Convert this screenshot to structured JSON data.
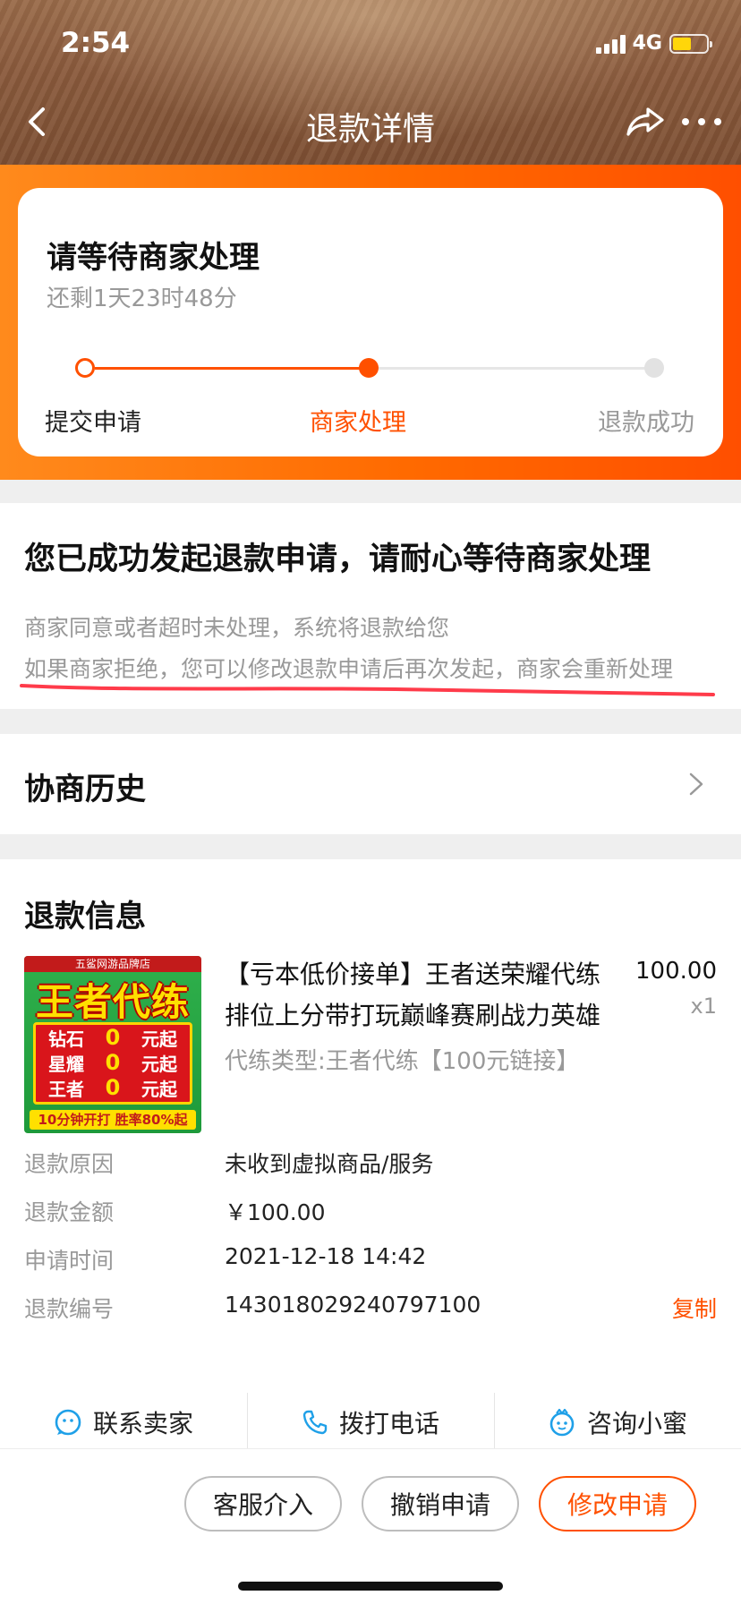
{
  "status_bar": {
    "time": "2:54",
    "network": "4G"
  },
  "nav": {
    "title": "退款详情"
  },
  "progress": {
    "title": "请等待商家处理",
    "remaining": "还剩1天23时48分",
    "steps": [
      "提交申请",
      "商家处理",
      "退款成功"
    ],
    "current_step": 2
  },
  "notice": {
    "title": "您已成功发起退款申请，请耐心等待商家处理",
    "line1": "商家同意或者超时未处理，系统将退款给您",
    "line2": "如果商家拒绝，您可以修改退款申请后再次发起，商家会重新处理"
  },
  "history": {
    "label": "协商历史"
  },
  "refund_info": {
    "section_title": "退款信息",
    "product": {
      "title_line1": "【亏本低价接单】王者送荣耀代练",
      "title_line2": "排位上分带打玩巅峰赛刷战力英雄",
      "price": "100.00",
      "qty": "x1",
      "spec": "代练类型:王者代练【100元链接】",
      "thumb": {
        "top": "五鲨网游品牌店",
        "main": "王者代练",
        "rows": [
          {
            "label": "钻石",
            "num": "0",
            "unit": "元起"
          },
          {
            "label": "星耀",
            "num": "0",
            "unit": "元起"
          },
          {
            "label": "王者",
            "num": "0",
            "unit": "元起"
          }
        ],
        "bottom": "10分钟开打  胜率80%起"
      }
    },
    "rows": {
      "reason": {
        "label": "退款原因",
        "value": "未收到虚拟商品/服务"
      },
      "amount": {
        "label": "退款金额",
        "value": "￥100.00"
      },
      "time": {
        "label": "申请时间",
        "value": "2021-12-18 14:42"
      },
      "number": {
        "label": "退款编号",
        "value": "143018029240797100",
        "action": "复制"
      }
    },
    "contacts": {
      "seller": "联系卖家",
      "phone": "拨打电话",
      "assistant": "咨询小蜜"
    }
  },
  "actions": {
    "service": "客服介入",
    "cancel": "撤销申请",
    "modify": "修改申请"
  },
  "colors": {
    "accent": "#ff5000",
    "header_brown": "#8a5a3c",
    "muted_text": "#999999"
  }
}
